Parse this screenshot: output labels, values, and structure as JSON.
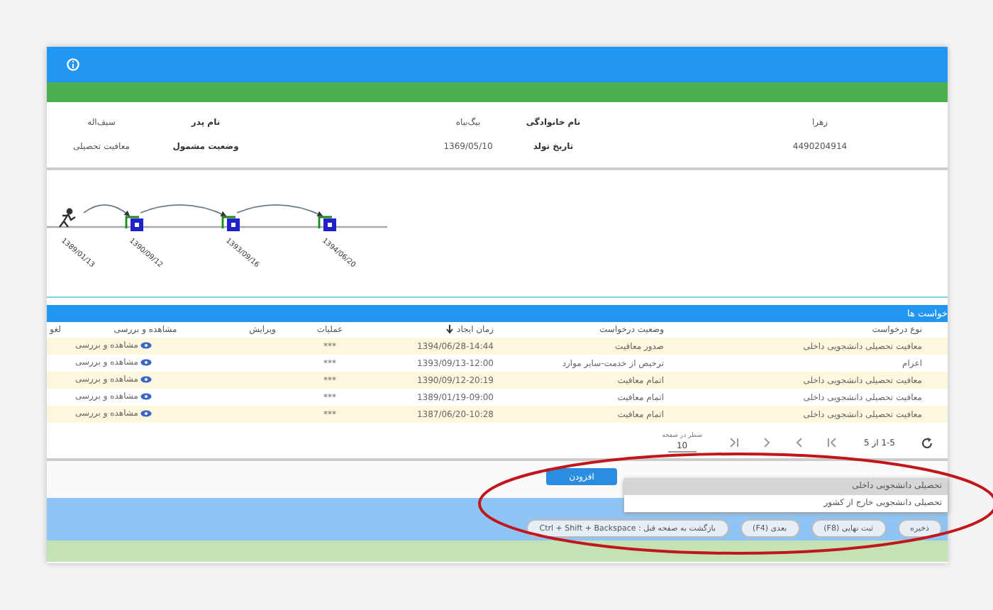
{
  "info": {
    "rows": [
      [
        {
          "value": "زهرا"
        },
        {
          "label": "نام خانوادگی",
          "value": "بیگ‌بیاه"
        },
        {
          "label": "نام پدر",
          "value": "سیف‌اله"
        }
      ],
      [
        {
          "value": "4490204914"
        },
        {
          "label": "تاریخ تولد",
          "value": "1369/05/10"
        },
        {
          "label": "وضعیت مشمول",
          "value": "معافیت تحصیلی"
        }
      ]
    ]
  },
  "timeline": {
    "start_date": "1389/01/13",
    "events": [
      {
        "date": "1390/09/12"
      },
      {
        "date": "1393/09/16"
      },
      {
        "date": "1394/06/20"
      }
    ]
  },
  "requests": {
    "title": "خواست ها",
    "columns": [
      "نوع درخواست",
      "وضعیت درخواست",
      "زمان ایجاد",
      "عملیات",
      "ویرایش",
      "مشاهده و بررسی",
      "لغو"
    ],
    "rows": [
      {
        "type": "معافیت تحصیلی دانشجویی داخلی",
        "status": "صدور معافیت",
        "created": "1394/06/28-14:44",
        "actions": "***",
        "view": "مشاهده و بررسی"
      },
      {
        "type": "اعزام",
        "status": "ترخیص از خدمت-سایر موارد",
        "created": "1393/09/13-12:00",
        "actions": "***",
        "view": "مشاهده و بررسی"
      },
      {
        "type": "معافیت تحصیلی دانشجویی داخلی",
        "status": "اتمام معافیت",
        "created": "1390/09/12-20:19",
        "actions": "***",
        "view": "مشاهده و بررسی"
      },
      {
        "type": "معافیت تحصیلی دانشجویی داخلی",
        "status": "اتمام معافیت",
        "created": "1389/01/19-09:00",
        "actions": "***",
        "view": "مشاهده و بررسی"
      },
      {
        "type": "معافیت تحصیلی دانشجویی داخلی",
        "status": "اتمام معافیت",
        "created": "1387/06/20-10:28",
        "actions": "***",
        "view": "مشاهده و بررسی"
      }
    ],
    "pagination": {
      "range": "1-5 از 5",
      "page_size_label": "سطر در صفحه",
      "page_size": "10"
    }
  },
  "add_button": "افزودن",
  "add_menu": [
    {
      "label": "تحصیلی دانشجویی داخلی",
      "selected": true
    },
    {
      "label": "تحصیلی دانشجویی خارج از کشور",
      "selected": false
    }
  ],
  "shortcuts": [
    "ذخیره",
    "ثبت نهایی (F8)",
    "بعدی (F4)",
    "بازگشت به صفحه قبل : Ctrl + Shift + Backspace"
  ]
}
